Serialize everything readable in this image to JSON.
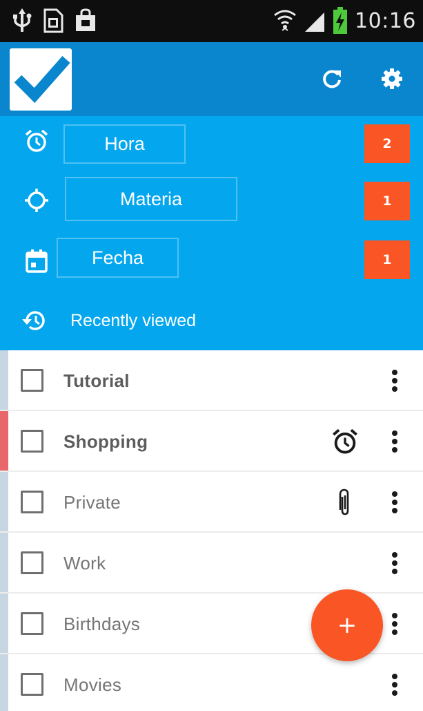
{
  "status_bar": {
    "time": "10:16",
    "icons": [
      "usb-icon",
      "sim-card-icon",
      "shopping-bag-icon",
      "wifi-icon",
      "signal-icon",
      "battery-charging-icon"
    ]
  },
  "app_bar": {
    "logo_icon": "checkmark-logo-icon",
    "actions": [
      "refresh-icon",
      "settings-icon"
    ]
  },
  "filters": [
    {
      "icon": "alarm-clock-icon",
      "label": "Hora",
      "count": "2"
    },
    {
      "icon": "crosshair-icon",
      "label": "Materia",
      "count": "1"
    },
    {
      "icon": "calendar-icon",
      "label": "Fecha",
      "count": "1"
    }
  ],
  "recently_viewed": {
    "icon": "history-icon",
    "label": "Recently viewed"
  },
  "lists": [
    {
      "label": "Tutorial",
      "bold": true,
      "stripe_color": "#c8d6e4",
      "meta_icon": ""
    },
    {
      "label": "Shopping",
      "bold": true,
      "stripe_color": "#e8676a",
      "meta_icon": "alarm-clock-icon"
    },
    {
      "label": "Private",
      "bold": false,
      "stripe_color": "#c8d6e4",
      "meta_icon": "paperclip-icon"
    },
    {
      "label": "Work",
      "bold": false,
      "stripe_color": "#c8d6e4",
      "meta_icon": ""
    },
    {
      "label": "Birthdays",
      "bold": false,
      "stripe_color": "#c8d6e4",
      "meta_icon": ""
    },
    {
      "label": "Movies",
      "bold": false,
      "stripe_color": "#c8d6e4",
      "meta_icon": ""
    }
  ],
  "fab": {
    "label": "+"
  },
  "colors": {
    "status_bar": "#0e0e0e",
    "app_bar": "#0a86cf",
    "filter_panel": "#04a6ee",
    "accent": "#fa5524"
  }
}
